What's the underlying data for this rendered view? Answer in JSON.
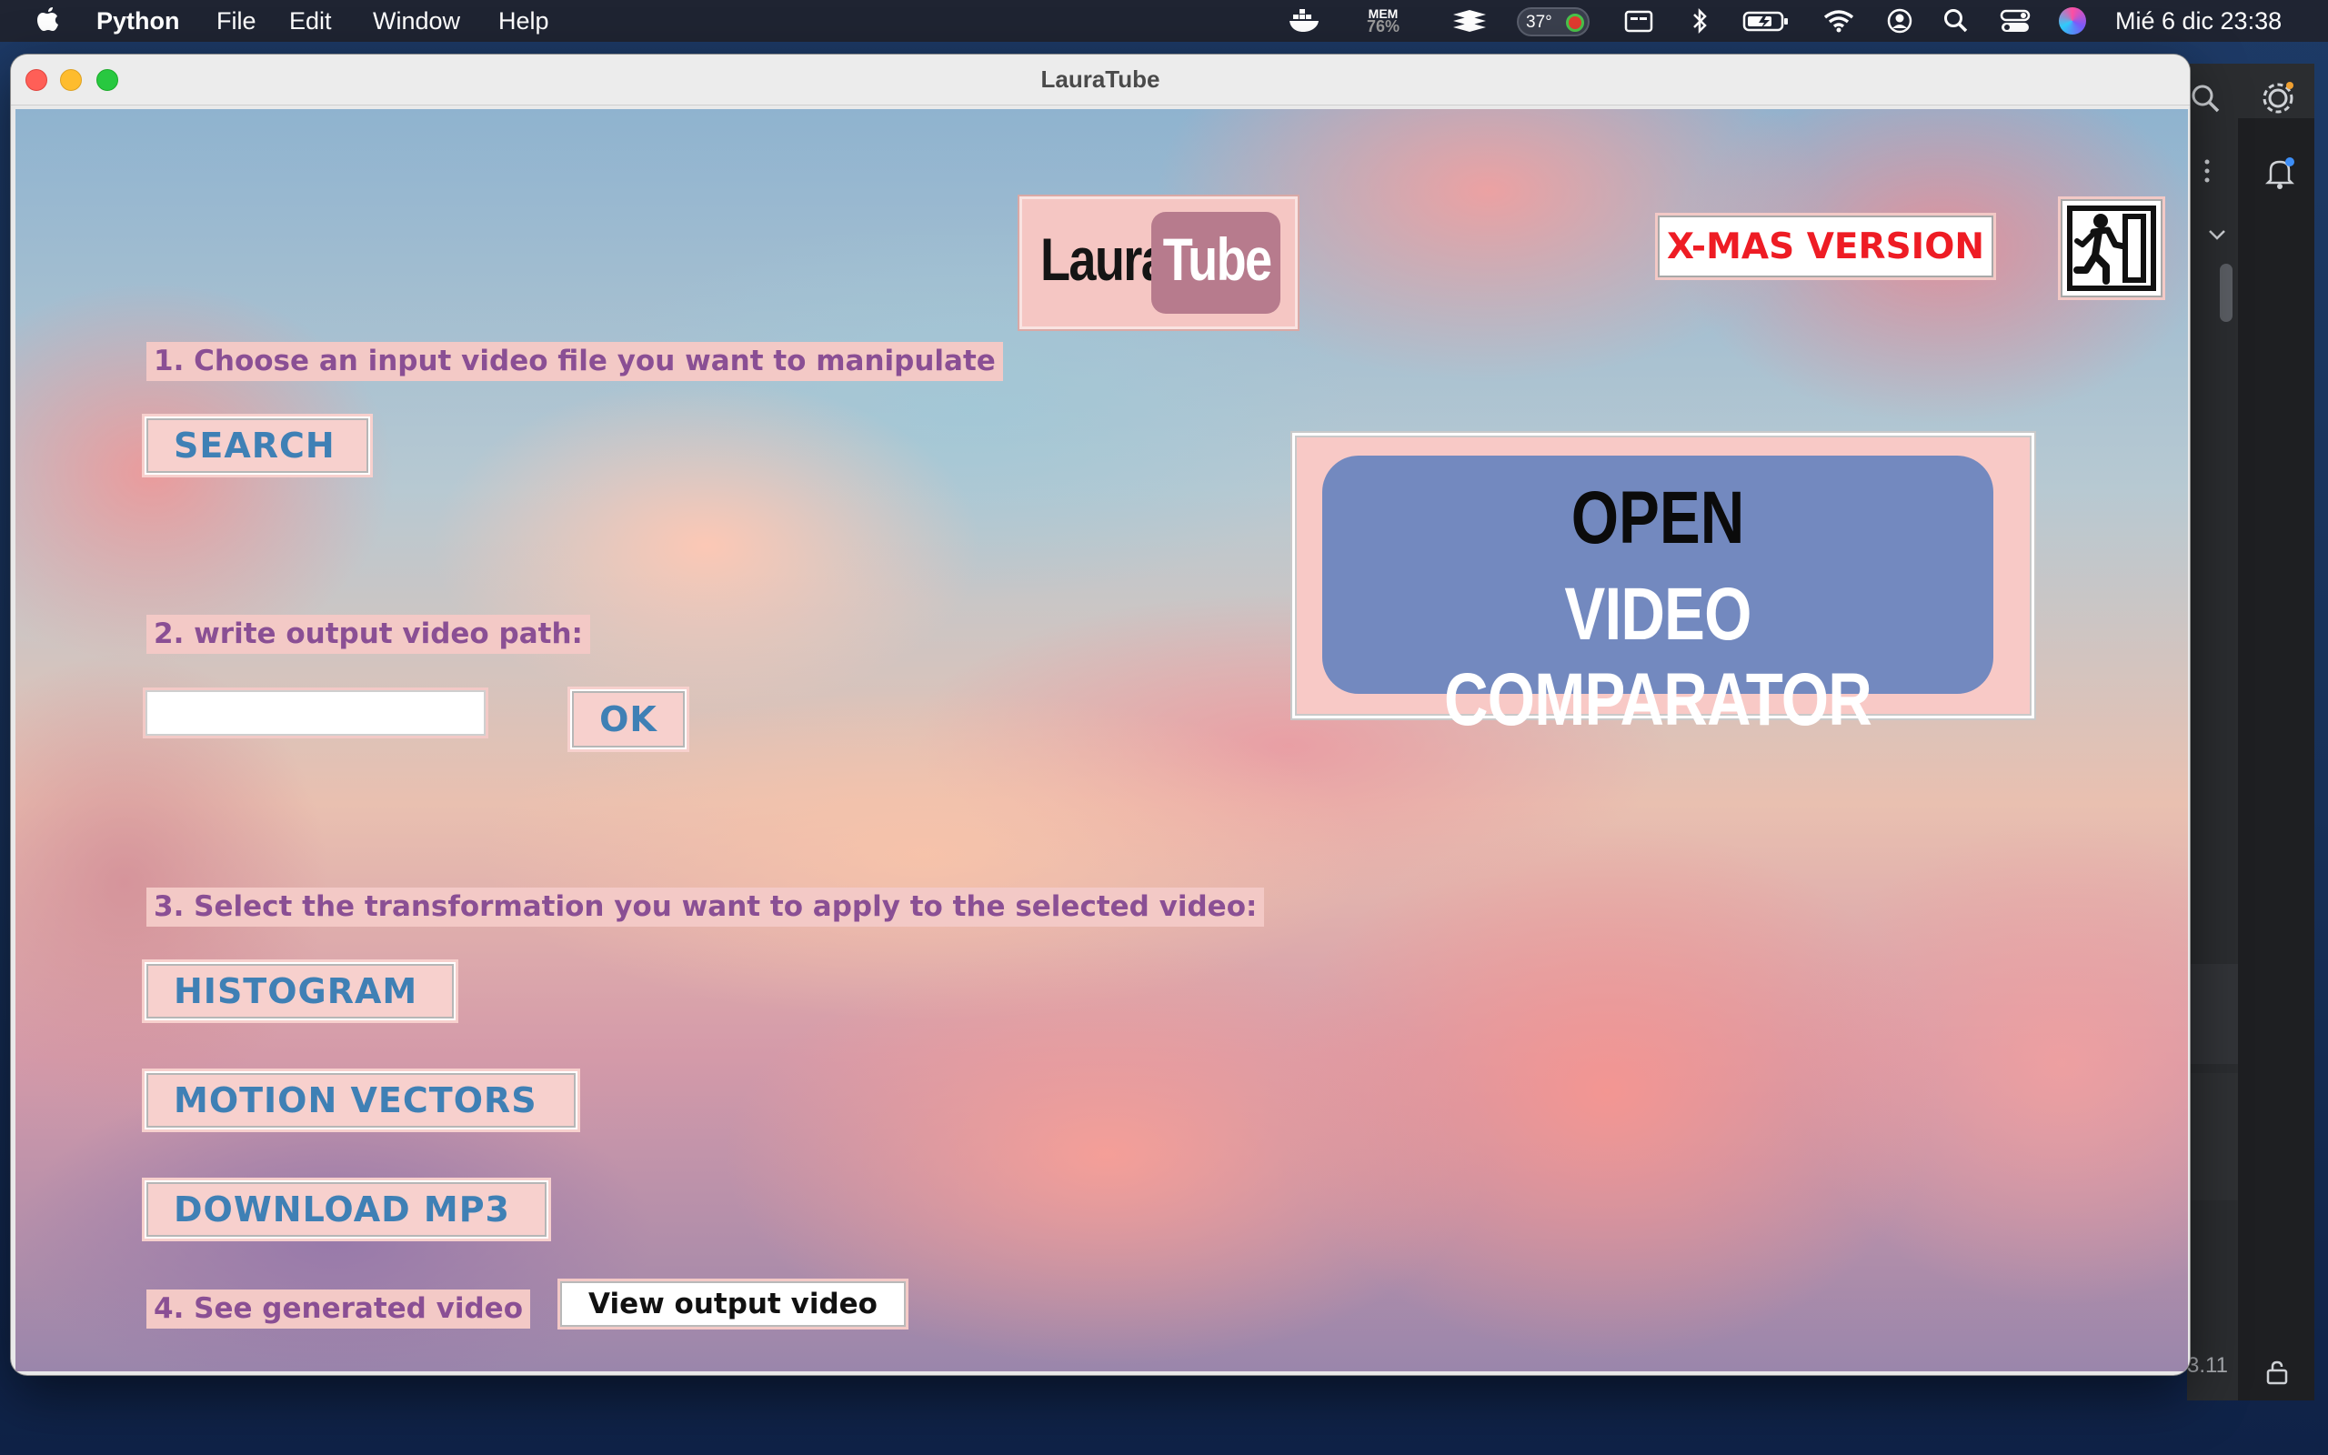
{
  "menubar": {
    "app_name": "Python",
    "menus": [
      "File",
      "Edit",
      "Window",
      "Help"
    ],
    "mem_label": "MEM",
    "mem_value": "76%",
    "temperature": "37°",
    "datetime": "Mié 6 dic  23:38"
  },
  "window": {
    "title": "LauraTube"
  },
  "logo": {
    "part1": "Laura",
    "part2": "Tube"
  },
  "xmas_button": "X-MAS VERSION",
  "step1": {
    "label": "1. Choose an input video file you want to manipulate",
    "button": "SEARCH"
  },
  "step2": {
    "label": "2. write output video path:",
    "input_value": "",
    "button": "OK"
  },
  "step3": {
    "label": "3. Select the transformation you want to apply to the selected video:",
    "buttons": [
      "HISTOGRAM",
      "MOTION VECTORS",
      "DOWNLOAD MP3"
    ]
  },
  "step4": {
    "label": "4. See generated video",
    "button": "View output video"
  },
  "comparator": {
    "line1": "OPEN",
    "line2": "VIDEO COMPARATOR"
  },
  "ide": {
    "version_fragment": "3.11"
  },
  "icons": {
    "exit": "exit-icon",
    "apple": "apple-icon"
  },
  "colors": {
    "label_text": "#8a4f94",
    "label_bg": "#f3c9c6",
    "button_text": "#3f80b5",
    "xmas_text": "#ee1c24",
    "comparator_bg": "#7389bf"
  }
}
